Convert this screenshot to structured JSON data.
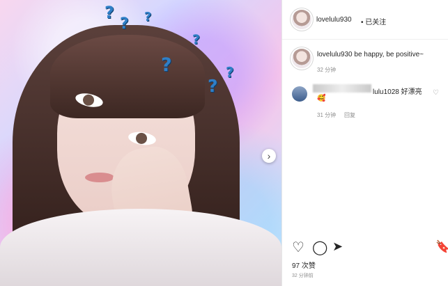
{
  "post": {
    "username": "lovelulu930",
    "follow_status": "• 已关注",
    "caption_username": "lovelulu930",
    "caption_text": "be happy, be positive~",
    "caption_time": "32 分钟",
    "comment": {
      "username_suffix": "lulu1028",
      "text": "好漂亮",
      "emoji": "🥰",
      "time": "31 分钟",
      "reply_label": "回复"
    },
    "likes": "97 次赞",
    "post_time": "32 分钟前"
  },
  "icons": {
    "heart_icon": "♡",
    "comment_icon": "◯",
    "share_icon": "➤",
    "bookmark_icon": "🔖",
    "next_arrow_icon": "›"
  },
  "photo_decor": {
    "question_mark": "?"
  }
}
